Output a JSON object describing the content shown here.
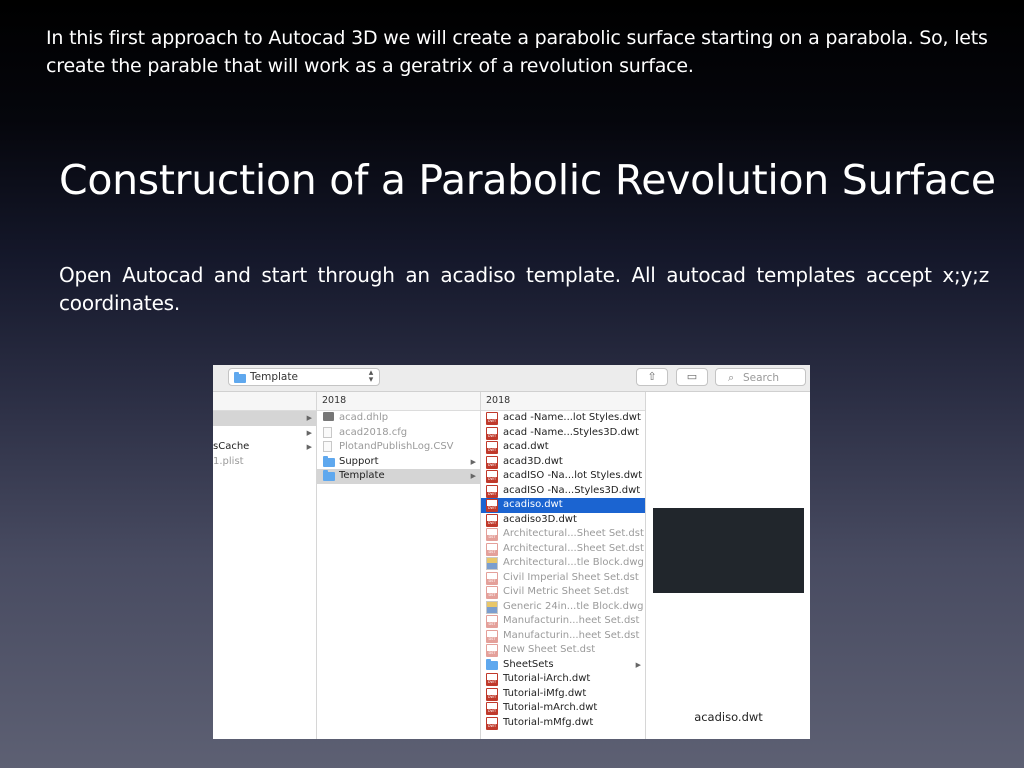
{
  "slide": {
    "intro": "In this first approach to Autocad 3D we will create a parabolic surface starting on a parabola. So, lets create the parable that will work as a geratrix of a revolution surface.",
    "title": "Construction of a Parabolic Revolution Surface",
    "body": "Open Autocad and start through an acadiso template. All autocad templates accept x;y;z coordinates."
  },
  "finder": {
    "path_label": "Template",
    "search_placeholder": "Search",
    "col1": {
      "rows": [
        {
          "label": "",
          "selected": true,
          "arrow": true
        },
        {
          "label": "",
          "arrow": true
        },
        {
          "label": "sCache",
          "arrow": true
        },
        {
          "label": "1.plist",
          "dim": true
        }
      ]
    },
    "col2": {
      "header": "2018",
      "rows": [
        {
          "label": "acad.dhlp",
          "icon": "cfg-icon",
          "dim": true
        },
        {
          "label": "acad2018.cfg",
          "icon": "document-icon",
          "dim": true
        },
        {
          "label": "PlotandPublishLog.CSV",
          "icon": "document-icon",
          "dim": true
        },
        {
          "label": "Support",
          "icon": "folder-icon",
          "arrow": true
        },
        {
          "label": "Template",
          "icon": "folder-icon",
          "arrow": true,
          "selected": true
        }
      ]
    },
    "col3": {
      "header": "2018",
      "rows": [
        {
          "label": "acad -Name...lot Styles.dwt",
          "icon": "dwt-icon"
        },
        {
          "label": "acad -Name...Styles3D.dwt",
          "icon": "dwt-icon"
        },
        {
          "label": "acad.dwt",
          "icon": "dwt-icon"
        },
        {
          "label": "acad3D.dwt",
          "icon": "dwt-icon"
        },
        {
          "label": "acadISO -Na...lot Styles.dwt",
          "icon": "dwt-icon"
        },
        {
          "label": "acadISO -Na...Styles3D.dwt",
          "icon": "dwt-icon"
        },
        {
          "label": "acadiso.dwt",
          "icon": "dwt-icon",
          "active": true
        },
        {
          "label": "acadiso3D.dwt",
          "icon": "dwt-icon"
        },
        {
          "label": "Architectural...Sheet Set.dst",
          "icon": "dst-icon",
          "dim": true
        },
        {
          "label": "Architectural...Sheet Set.dst",
          "icon": "dst-icon",
          "dim": true
        },
        {
          "label": "Architectural...tle Block.dwg",
          "icon": "dwg-icon",
          "dim": true
        },
        {
          "label": "Civil Imperial Sheet Set.dst",
          "icon": "dst-icon",
          "dim": true
        },
        {
          "label": "Civil Metric Sheet Set.dst",
          "icon": "dst-icon",
          "dim": true
        },
        {
          "label": "Generic 24in...tle Block.dwg",
          "icon": "dwg-icon",
          "dim": true
        },
        {
          "label": "Manufacturin...heet Set.dst",
          "icon": "dst-icon",
          "dim": true
        },
        {
          "label": "Manufacturin...heet Set.dst",
          "icon": "dst-icon",
          "dim": true
        },
        {
          "label": "New Sheet Set.dst",
          "icon": "dst-icon",
          "dim": true
        },
        {
          "label": "SheetSets",
          "icon": "folder-icon",
          "arrow": true
        },
        {
          "label": "Tutorial-iArch.dwt",
          "icon": "dwt-icon"
        },
        {
          "label": "Tutorial-iMfg.dwt",
          "icon": "dwt-icon"
        },
        {
          "label": "Tutorial-mArch.dwt",
          "icon": "dwt-icon"
        },
        {
          "label": "Tutorial-mMfg.dwt",
          "icon": "dwt-icon"
        }
      ]
    },
    "preview": {
      "filename": "acadiso.dwt"
    }
  }
}
